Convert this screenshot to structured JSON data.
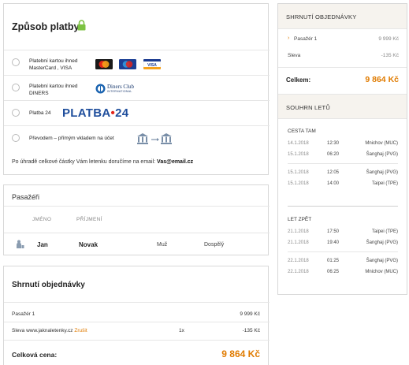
{
  "payment": {
    "title": "Způsob platby",
    "options": [
      {
        "line1": "Platební kartou ihned",
        "line2": "MasterCard , VISA"
      },
      {
        "line1": "Platební kartou ihned",
        "line2": "DINERS"
      },
      {
        "line1": "Platba 24",
        "line2": ""
      },
      {
        "line1": "Převodem – přímým vkladem na účet",
        "line2": ""
      }
    ],
    "diners_logo_text": "Diners Club",
    "diners_logo_sub": "INTERNATIONAL",
    "platba_logo_main": "PLATBA",
    "platba_logo_dot": "•",
    "platba_logo_num": "24",
    "note_prefix": "Po úhradě celkové částky Vám letenku doručíme na email:",
    "note_email": "Vas@email.cz"
  },
  "passengers": {
    "title": "Pasažéři",
    "col_name": "JMÉNO",
    "col_surname": "PŘÍJMENÍ",
    "row": {
      "name": "Jan",
      "surname": "Novak",
      "gender": "Muž",
      "type": "Dospělý"
    }
  },
  "summary": {
    "title": "Shrnutí objednávky",
    "row1_label": "Pasažér 1",
    "row1_value": "9 999 Kč",
    "row2_label": "Sleva www.jaknaletenky.cz",
    "row2_link": "Zrušit",
    "row2_qty": "1x",
    "row2_value": "-135 Kč",
    "total_label": "Celková cena:",
    "total_value": "9 864 Kč"
  },
  "side": {
    "header": "SHRNUTÍ OBJEDNÁVKY",
    "row1_label": "Pasažér 1",
    "row1_value": "9 999 Kč",
    "row2_label": "Sleva",
    "row2_value": "-135 Kč",
    "total_label": "Celkem:",
    "total_value": "9 864 Kč",
    "flights_header": "SOUHRN LETŮ",
    "out_title": "CESTA TAM",
    "ret_title": "LET ZPĚT",
    "out": [
      {
        "date": "14.1.2018",
        "time": "12:30",
        "city": "Mnichov (MUC)"
      },
      {
        "date": "15.1.2018",
        "time": "06:20",
        "city": "Šanghaj (PVG)"
      },
      {
        "date": "15.1.2018",
        "time": "12:05",
        "city": "Šanghaj (PVG)"
      },
      {
        "date": "15.1.2018",
        "time": "14:00",
        "city": "Taipei (TPE)"
      }
    ],
    "ret": [
      {
        "date": "21.1.2018",
        "time": "17:50",
        "city": "Taipei (TPE)"
      },
      {
        "date": "21.1.2018",
        "time": "19:40",
        "city": "Šanghaj (PVG)"
      },
      {
        "date": "22.1.2018",
        "time": "01:25",
        "city": "Šanghaj (PVG)"
      },
      {
        "date": "22.1.2018",
        "time": "06:25",
        "city": "Mnichov (MUC)"
      }
    ]
  },
  "colors": {
    "accent": "#e07b00",
    "lock": "#7cc242",
    "platba_blue": "#1f4e9c",
    "platba_red": "#e2241a"
  }
}
